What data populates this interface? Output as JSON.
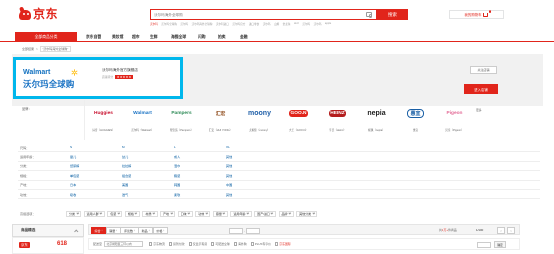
{
  "header": {
    "logo_text": "京东",
    "search": {
      "placeholder": "沃尔玛海外全球购",
      "button_label": "搜索"
    },
    "hot_words": [
      "沃尔玛",
      "沃尔玛全球购",
      "沃尔玛",
      "沃尔玛海外全球购",
      "沃尔玛进口",
      "沃尔玛官方",
      "进口零食",
      "沃尔玛",
      "山姆",
      "金龙鱼",
      "sk-II",
      "沃尔玛",
      "沃尔玛",
      "apple"
    ],
    "cart": {
      "label": "我的购物车",
      "count": "0"
    }
  },
  "nav": {
    "category_label": "全部商品分类",
    "items": [
      "京东自营",
      "美妆馆",
      "超市",
      "生鲜",
      "海囤全球",
      "闪购",
      "拍卖",
      "金融"
    ]
  },
  "breadcrumb": {
    "items": [
      "全部结果",
      "沃尔玛海外全球购"
    ]
  },
  "shop": {
    "logo_en": "Walmart",
    "logo_cn": "沃尔玛全球购",
    "name": "沃尔玛海外官方旗舰店",
    "score_label": "店铺评分",
    "stars": "★★★★★",
    "follow_label": "关注店铺",
    "enter_label": "进入店铺"
  },
  "brands": {
    "label": "品牌：",
    "more_label": "更多",
    "items": [
      {
        "logo": "Huggies",
        "name": "好奇（HUGGIES）",
        "color": "#c8102e"
      },
      {
        "logo": "Walmart",
        "name": "沃尔玛（Walmart）",
        "color": "#1a73c4"
      },
      {
        "logo": "Pampers",
        "name": "帮宝适（Pampers）",
        "color": "#2e8b57"
      },
      {
        "logo": "汇宏",
        "name": "汇宏（HUI YONG）",
        "color": "#8b4513"
      },
      {
        "logo": "moony",
        "name": "尤妮佳（moony）",
        "color": "#1f5fa8"
      },
      {
        "logo": "GOO.N",
        "name": "大王（GOO.N）",
        "color": "#e1251b"
      },
      {
        "logo": "HEINZ",
        "name": "亨氏（Heinz）",
        "color": "#b41d1d"
      },
      {
        "logo": "nepia",
        "name": "妮飘（nepia）",
        "color": "#222222"
      },
      {
        "logo": "惠宜",
        "name": "惠宜",
        "color": "#1a5fa5"
      },
      {
        "logo": "Pigeon",
        "name": "贝亲（Pigeon）",
        "color": "#e36a96"
      }
    ]
  },
  "attributes": [
    {
      "key": "尺码：",
      "values": [
        "S",
        "M",
        "L",
        "XL"
      ]
    },
    {
      "key": "适用年龄：",
      "values": [
        "婴儿",
        "幼儿",
        "成人",
        "其他"
      ]
    },
    {
      "key": "分类：",
      "values": [
        "纸尿裤",
        "拉拉裤",
        "湿巾",
        "其他"
      ]
    },
    {
      "key": "规格：",
      "values": [
        "单包装",
        "组合装",
        "箱装",
        "其他"
      ]
    },
    {
      "key": "产地：",
      "values": [
        "日本",
        "美国",
        "韩国",
        "中国"
      ]
    },
    {
      "key": "功效：",
      "values": [
        "吸收",
        "透气",
        "柔软",
        "其他"
      ]
    }
  ],
  "advanced": {
    "label": "高级选项：",
    "items": [
      "分类",
      "适用人群",
      "包装",
      "规格",
      "材质",
      "产地",
      "口味",
      "功效",
      "容量",
      "适用年龄",
      "国产/进口",
      "品牌",
      "其他分类"
    ]
  },
  "left_panel": {
    "title": "商品精选",
    "promo_tag": "京东",
    "promo_text": "618"
  },
  "sort_bar": {
    "tabs": [
      "综合",
      "销量",
      "评论数",
      "新品",
      "价格"
    ],
    "count_prefix": "共",
    "count_value": "1万+",
    "count_suffix": "件商品",
    "pager": "1/100",
    "prev": "<",
    "next": ">"
  },
  "filter_bar": {
    "ship_label": "配送至",
    "ship_value": "北京朝阳区三环以内",
    "checks": [
      "京东物流",
      "货到付款",
      "仅显示有货",
      "可配送全球",
      "海外购",
      "PLUS专享价",
      "京东国际"
    ],
    "ok_label": "确定"
  }
}
